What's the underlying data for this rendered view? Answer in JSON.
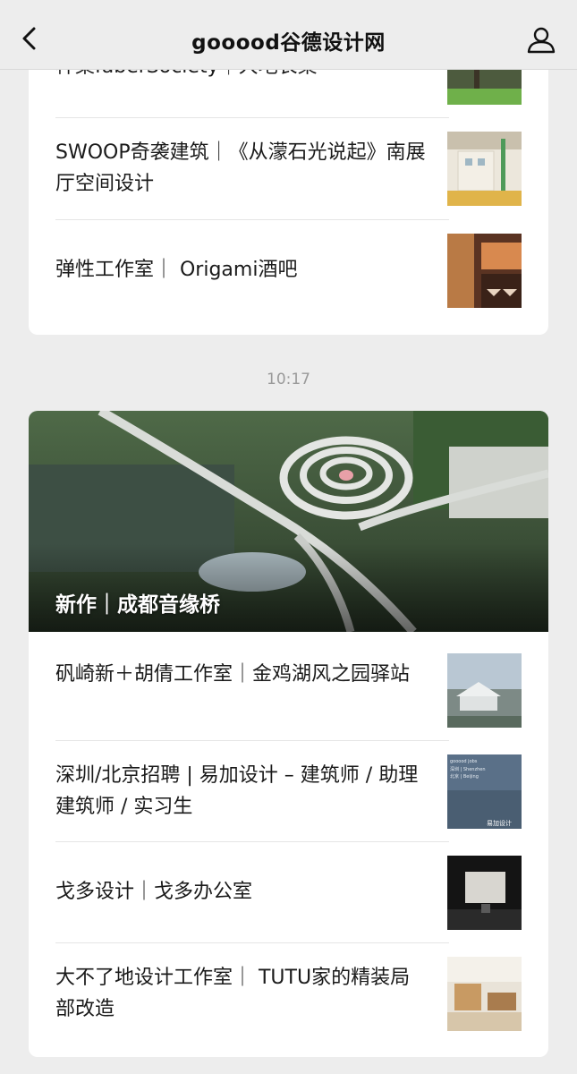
{
  "nav": {
    "title": "gooood谷德设计网",
    "back_icon": "chevron-left-icon",
    "profile_icon": "person-icon"
  },
  "top_card": {
    "items": [
      {
        "title": "梓集faberSociety｜大地长桌"
      },
      {
        "title": "SWOOP奇袭建筑｜《从濛石光说起》南展厅空间设计"
      },
      {
        "title": "弹性工作室｜ Origami酒吧"
      }
    ]
  },
  "timestamp": "10:17",
  "bottom_card": {
    "hero_title": "新作｜成都音缘桥",
    "items": [
      {
        "title": "矾崎新＋胡倩工作室｜金鸡湖风之园驿站"
      },
      {
        "title": "深圳/北京招聘 | 易加设计 – 建筑师 / 助理建筑师 / 实习生"
      },
      {
        "title": "戈多设计｜戈多办公室"
      },
      {
        "title": "大不了地设计工作室｜ TUTU家的精装局部改造"
      }
    ],
    "thumb_text": {
      "jobs_header": "gooood jobs",
      "jobs_line1": "深圳 | Shenzhen",
      "jobs_line2": "北京 | Beijing",
      "jobs_brand": "易加设计"
    }
  }
}
